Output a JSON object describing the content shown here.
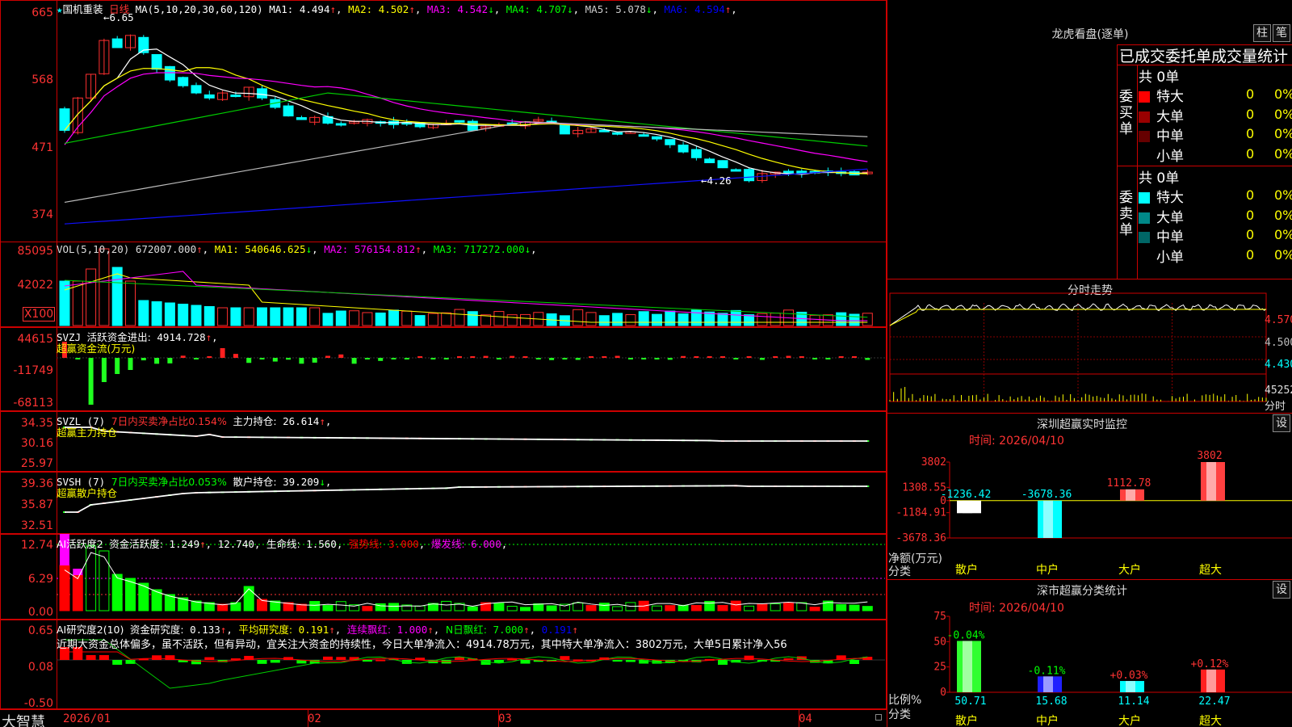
{
  "price_pane": {
    "title_star": "★",
    "stock_name": "国机重装",
    "period": "日线",
    "ma_header": "MA(5,10,20,30,60,120)",
    "ma_items": [
      {
        "label": "MA1:",
        "value": "4.494",
        "arrow": "↑",
        "color": "#ffffff"
      },
      {
        "label": "MA2:",
        "value": "4.502",
        "arrow": "↑",
        "color": "#ffff00"
      },
      {
        "label": "MA3:",
        "value": "4.542",
        "arrow": "↓",
        "color": "#ff00ff"
      },
      {
        "label": "MA4:",
        "value": "4.707",
        "arrow": "↓",
        "color": "#00ff00"
      },
      {
        "label": "MA5:",
        "value": "5.078",
        "arrow": "↓",
        "color": "#cccccc"
      },
      {
        "label": "MA6:",
        "value": "4.594",
        "arrow": "↑",
        "color": "#0000ff"
      }
    ],
    "y_ticks": [
      "665",
      "568",
      "471",
      "374"
    ],
    "high_marker": "6.65",
    "low_marker": "4.26",
    "ylim": [
      3.6,
      6.8
    ]
  },
  "vol_pane": {
    "header": "VOL(5,10,20)",
    "value": "672007.000",
    "items": [
      {
        "label": "MA1:",
        "value": "540646.625",
        "arrow": "↓",
        "color": "#ffff00"
      },
      {
        "label": "MA2:",
        "value": "576154.812",
        "arrow": "↑",
        "color": "#ff00ff"
      },
      {
        "label": "MA3:",
        "value": "717272.000",
        "arrow": "↓",
        "color": "#00ff00"
      }
    ],
    "y_ticks": [
      "85095",
      "42022",
      "X100"
    ]
  },
  "svzj_pane": {
    "header": "SVZJ",
    "label": "活跃资金进出:",
    "value": "4914.728",
    "arrow": "↑",
    "sub": "超赢资金流(万元)",
    "y_ticks": [
      "44615",
      "-11749",
      "-68113"
    ]
  },
  "svzl_pane": {
    "header": "SVZL (7)",
    "pct_label": "7日内买卖净占比0.154%",
    "label": "主力持仓:",
    "value": "26.614",
    "arrow": "↑",
    "sub": "超赢主力持仓",
    "y_ticks": [
      "34.35",
      "30.16",
      "25.97"
    ]
  },
  "svsh_pane": {
    "header": "SVSH (7)",
    "pct_label": "7日内买卖净占比0.053%",
    "label": "散户持仓:",
    "value": "39.209",
    "arrow": "↓",
    "sub": "超赢散户持仓",
    "y_ticks": [
      "39.36",
      "35.87",
      "32.51"
    ]
  },
  "ai_active_pane": {
    "header": "AI活跃度2",
    "label": "资金活跃度:",
    "value": "1.249",
    "value2": "12.740",
    "life_label": "生命线:",
    "life_value": "1.560",
    "strong_label": "强势线:",
    "strong_value": "3.000",
    "burst_label": "爆发线:",
    "burst_value": "6.000",
    "y_ticks": [
      "12.74",
      "6.29",
      "0.00"
    ]
  },
  "ai_research_pane": {
    "header": "AI研究度2(10)",
    "label": "资金研究度:",
    "value": "0.133",
    "avg_label": "平均研究度:",
    "avg_value": "0.191",
    "streak_label": "连续飘红:",
    "streak_value": "1.000",
    "n_label": "N日飘红:",
    "n_value": "7.000",
    "last_value": "0.191",
    "comment": "近期大资金总体偏多，虽不活跃，但有异动，宜关注大资金的持续性，今日大单净流入：4914.78万元，其中特大单净流入：3802万元，大单5日累计净入56",
    "y_ticks": [
      "0.65",
      "0.08",
      "-0.50"
    ]
  },
  "x_axis": {
    "brand": "大智慧",
    "labels": [
      "2026/01",
      "02",
      "03",
      "04"
    ]
  },
  "dragon_tiger": {
    "title": "龙虎看盘(逐单)",
    "btn_bar": "柱",
    "btn_pen": "笔",
    "subtitle": "已成交委托单成交量统计",
    "buy_label": "委买单",
    "sell_label": "委卖单",
    "buy_total": "共 0单",
    "sell_total": "共 0单",
    "buy_rows": [
      {
        "name": "特大",
        "count": "0",
        "pct": "0%",
        "color": "#ff0000"
      },
      {
        "name": "大单",
        "count": "0",
        "pct": "0%",
        "color": "#990000"
      },
      {
        "name": "中单",
        "count": "0",
        "pct": "0%",
        "color": "#660000"
      },
      {
        "name": "小单",
        "count": "0",
        "pct": "0%",
        "color": "#000000"
      }
    ],
    "sell_rows": [
      {
        "name": "特大",
        "count": "0",
        "pct": "0%",
        "color": "#00ffff"
      },
      {
        "name": "大单",
        "count": "0",
        "pct": "0%",
        "color": "#008888"
      },
      {
        "name": "中单",
        "count": "0",
        "pct": "0%",
        "color": "#006666"
      },
      {
        "name": "小单",
        "count": "0",
        "pct": "0%",
        "color": "#000000"
      }
    ]
  },
  "intraday": {
    "title": "分时走势",
    "y_ticks": [
      "4.570",
      "4.500",
      "4.430"
    ],
    "vol_label": "45252",
    "vol_sub": "分时"
  },
  "sz_monitor": {
    "title": "深圳超赢实时监控",
    "btn": "设",
    "time_label": "时间: 2026/04/10",
    "y_ticks": [
      "3802",
      "1308.55",
      "0",
      "-1184.91",
      "-3678.36"
    ],
    "y_title": "净额(万元)",
    "x_title": "分类",
    "chart_data": {
      "type": "bar",
      "categories": [
        "散户",
        "中户",
        "大户",
        "超大"
      ],
      "values": [
        -1236.42,
        -3678.36,
        1112.78,
        3802
      ],
      "value_labels": [
        "-1236.42",
        "-3678.36",
        "1112.78",
        "3802"
      ],
      "ylim": [
        -3678.36,
        3802
      ]
    }
  },
  "sz_class": {
    "title": "深市超赢分类统计",
    "btn": "设",
    "time_label": "时间: 2026/04/10",
    "y_ticks": [
      "75",
      "50",
      "25",
      "0"
    ],
    "y_title": "比例%",
    "x_title": "分类",
    "chart_data": {
      "type": "bar",
      "categories": [
        "散户",
        "中户",
        "大户",
        "超大"
      ],
      "values": [
        50.71,
        15.68,
        11.14,
        22.47
      ],
      "changes": [
        "-0.04%",
        "-0.11%",
        "+0.03%",
        "+0.12%"
      ],
      "ylim": [
        0,
        75
      ]
    }
  }
}
